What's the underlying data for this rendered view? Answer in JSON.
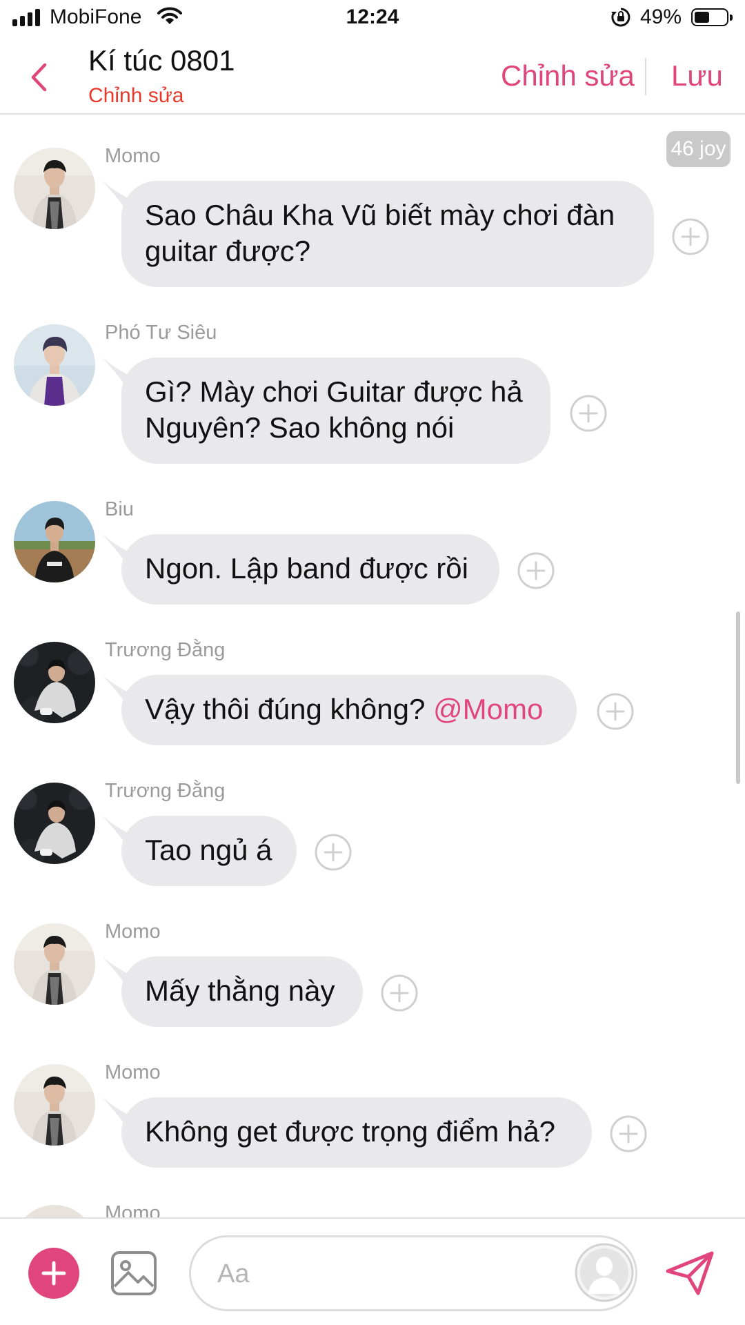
{
  "status_bar": {
    "carrier": "MobiFone",
    "time": "12:24",
    "battery_percent": "49%",
    "battery_level": 0.49,
    "signal_icon": "signal-bars-icon",
    "wifi_icon": "wifi-icon",
    "rotation_lock_icon": "rotation-lock-icon"
  },
  "header": {
    "title": "Kí túc 0801",
    "subtitle": "Chỉnh sửa",
    "edit_label": "Chỉnh sửa",
    "save_label": "Lưu",
    "back_icon": "chevron-left-icon",
    "accent_color": "#e0457b",
    "subtitle_color": "#e6392b"
  },
  "badge": {
    "label": "46 joy"
  },
  "messages": [
    {
      "sender": "Momo",
      "lines": [
        "Sao Châu Kha Vũ biết mày chơi đàn",
        "guitar được?"
      ]
    },
    {
      "sender": "Phó Tư Siêu",
      "lines": [
        "Gì? Mày chơi Guitar được hả",
        "Nguyên? Sao không nói"
      ]
    },
    {
      "sender": "Biu",
      "lines": [
        "Ngon. Lập band được rồi"
      ]
    },
    {
      "sender": "Trương Đằng",
      "text": "Vậy thôi đúng không?",
      "mention": "@Momo"
    },
    {
      "sender": "Trương Đằng",
      "lines": [
        "Tao ngủ á"
      ]
    },
    {
      "sender": "Momo",
      "lines": [
        "Mấy thằng này"
      ]
    },
    {
      "sender": "Momo",
      "lines": [
        "Không get được trọng điểm hả?"
      ]
    },
    {
      "sender": "Momo",
      "lines": []
    }
  ],
  "input": {
    "placeholder": "Aa",
    "value": "",
    "add_icon": "plus-icon",
    "image_icon": "image-icon",
    "profile_icon": "user-silhouette-icon",
    "send_icon": "send-icon"
  },
  "colors": {
    "bubble": "#e9e9eb",
    "accent": "#e0457b",
    "sender_gray": "#9a9a9a"
  }
}
